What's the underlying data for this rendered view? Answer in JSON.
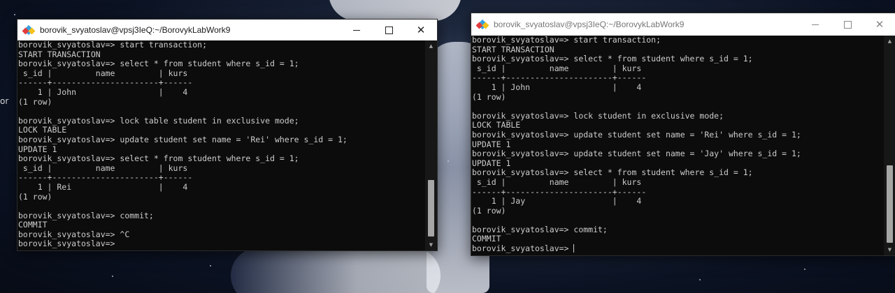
{
  "desktop": {
    "edge_text": "or"
  },
  "left_window": {
    "title": "borovik_svyatoslav@vpsj3IeQ:~/BorovykLabWork9",
    "lines": [
      "borovik_svyatoslav=> start transaction;",
      "START TRANSACTION",
      "borovik_svyatoslav=> select * from student where s_id = 1;",
      " s_id |         name         | kurs",
      "------+----------------------+------",
      "    1 | John                 |    4",
      "(1 row)",
      "",
      "borovik_svyatoslav=> lock table student in exclusive mode;",
      "LOCK TABLE",
      "borovik_svyatoslav=> update student set name = 'Rei' where s_id = 1;",
      "UPDATE 1",
      "borovik_svyatoslav=> select * from student where s_id = 1;",
      " s_id |         name         | kurs",
      "------+----------------------+------",
      "    1 | Rei                  |    4",
      "(1 row)",
      "",
      "borovik_svyatoslav=> commit;",
      "COMMIT",
      "borovik_svyatoslav=> ^C",
      "borovik_svyatoslav=>"
    ]
  },
  "right_window": {
    "title": "borovik_svyatoslav@vpsj3IeQ:~/BorovykLabWork9",
    "lines": [
      "borovik_svyatoslav=> start transaction;",
      "START TRANSACTION",
      "borovik_svyatoslav=> select * from student where s_id = 1;",
      " s_id |         name         | kurs",
      "------+----------------------+------",
      "    1 | John                 |    4",
      "(1 row)",
      "",
      "borovik_svyatoslav=> lock student in exclusive mode;",
      "LOCK TABLE",
      "borovik_svyatoslav=> update student set name = 'Rei' where s_id = 1;",
      "UPDATE 1",
      "borovik_svyatoslav=> update student set name = 'Jay' where s_id = 1;",
      "UPDATE 1",
      "borovik_svyatoslav=> select * from student where s_id = 1;",
      " s_id |         name         | kurs",
      "------+----------------------+------",
      "    1 | Jay                  |    4",
      "(1 row)",
      "",
      "borovik_svyatoslav=> commit;",
      "COMMIT",
      "borovik_svyatoslav=> "
    ]
  },
  "window_controls": {
    "close_symbol": "✕"
  },
  "colors": {
    "terminal_bg": "#0c0c0c",
    "terminal_fg": "#cccccc",
    "titlebar_bg": "#ffffff"
  }
}
